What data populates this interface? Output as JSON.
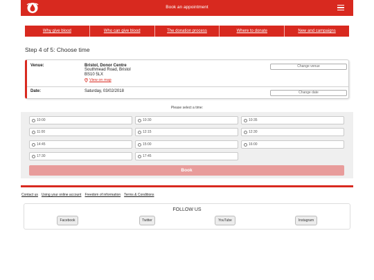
{
  "header": {
    "title": "Book an appointment",
    "menu_icon": "hamburger-icon",
    "logo_icon": "blood-drop-logo-icon",
    "brand_color": "#d8291f"
  },
  "nav": {
    "items": [
      {
        "label": "Why give blood"
      },
      {
        "label": "Who can give blood"
      },
      {
        "label": "The donation process"
      },
      {
        "label": "Where to donate"
      },
      {
        "label": "New and campaigns"
      }
    ]
  },
  "step": {
    "title": "Step 4 of 5: Choose time"
  },
  "details": {
    "venue_label": "Venue:",
    "venue_name": "Bristol, Donor Centre",
    "venue_address1": "Southmead Road, Bristol",
    "venue_postcode": "BS10 5LX",
    "map_link": "View on map",
    "change_venue": "Change venue",
    "date_label": "Date:",
    "date_value": "Saturday, 03/02/2018",
    "change_date": "Change date"
  },
  "slots": {
    "prompt": "Please select a time:",
    "times": [
      "10:00",
      "10:30",
      "10:35",
      "11:00",
      "12:15",
      "12:30",
      "14:45",
      "15:00",
      "16:00",
      "17:30",
      "17:45"
    ],
    "book_label": "Book",
    "book_color": "#e89c9b"
  },
  "footer": {
    "links": [
      "Contact us",
      "Using your online account",
      "Freedom of information",
      "Terms & Conditions"
    ],
    "follow_title": "FOLLOW US",
    "social": [
      "Facebook",
      "Twitter",
      "YouTube",
      "Instagram"
    ]
  }
}
